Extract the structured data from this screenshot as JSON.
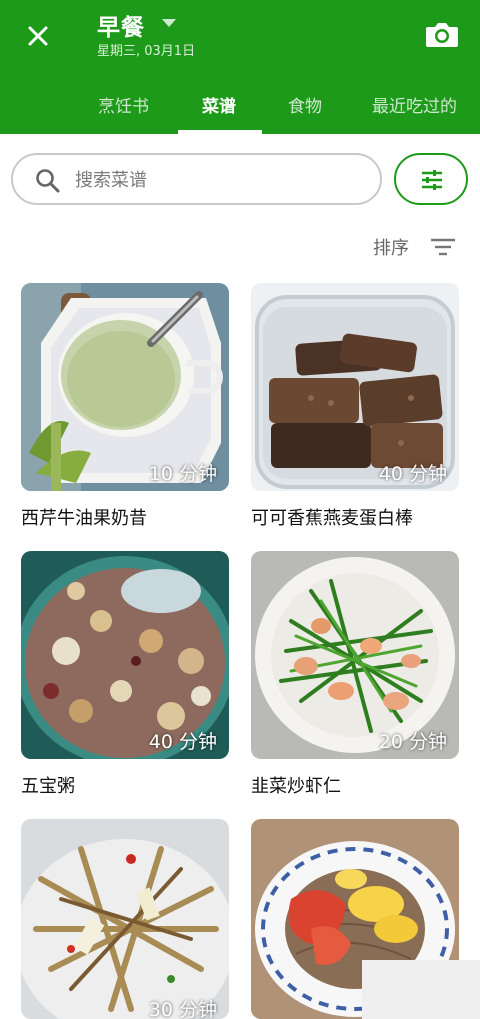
{
  "header": {
    "title": "早餐",
    "subtitle": "星期三, 03月1日",
    "close_icon": "close-icon",
    "camera_icon": "camera-icon",
    "brand_color": "#1d9a1a"
  },
  "tabs": [
    {
      "label": "烹饪书",
      "active": false
    },
    {
      "label": "菜谱",
      "active": true
    },
    {
      "label": "食物",
      "active": false
    },
    {
      "label": "最近吃过的",
      "active": false
    }
  ],
  "search": {
    "placeholder": "搜索菜谱",
    "value": ""
  },
  "sort": {
    "label": "排序"
  },
  "recipes": [
    {
      "title": "西芹牛油果奶昔",
      "time": "10 分钟"
    },
    {
      "title": "可可香蕉燕麦蛋白棒",
      "time": "40 分钟"
    },
    {
      "title": "五宝粥",
      "time": "40 分钟"
    },
    {
      "title": "韭菜炒虾仁",
      "time": "20 分钟"
    },
    {
      "title": "",
      "time": "30 分钟"
    },
    {
      "title": "",
      "time": ""
    }
  ]
}
